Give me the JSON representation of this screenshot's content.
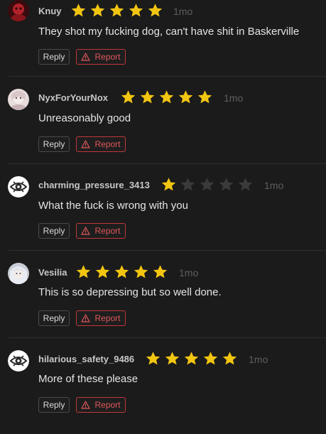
{
  "colors": {
    "background": "#1b1b1b",
    "star_filled": "#f2c511",
    "star_empty": "#3a3a3a",
    "report": "#c1373b"
  },
  "comments": [
    {
      "username": "Knuy",
      "rating": 5,
      "time": "1mo",
      "text": "They shot my fucking dog, can't have shit in Baskerville",
      "reply_label": "Reply",
      "report_label": "Report",
      "avatar_icon": "red-portrait-avatar"
    },
    {
      "username": "NyxForYourNox",
      "rating": 5,
      "time": "1mo",
      "text": "Unreasonably good",
      "reply_label": "Reply",
      "report_label": "Report",
      "avatar_icon": "pale-portrait-avatar"
    },
    {
      "username": "charming_pressure_3413",
      "rating": 1,
      "time": "1mo",
      "text": "What the fuck is wrong with you",
      "reply_label": "Reply",
      "report_label": "Report",
      "avatar_icon": "default-eye-avatar"
    },
    {
      "username": "Vesilia",
      "rating": 5,
      "time": "1mo",
      "text": "This is so depressing but so well done.",
      "reply_label": "Reply",
      "report_label": "Report",
      "avatar_icon": "silver-hair-portrait-avatar"
    },
    {
      "username": "hilarious_safety_9486",
      "rating": 5,
      "time": "1mo",
      "text": "More of these please",
      "reply_label": "Reply",
      "report_label": "Report",
      "avatar_icon": "default-eye-avatar"
    }
  ]
}
